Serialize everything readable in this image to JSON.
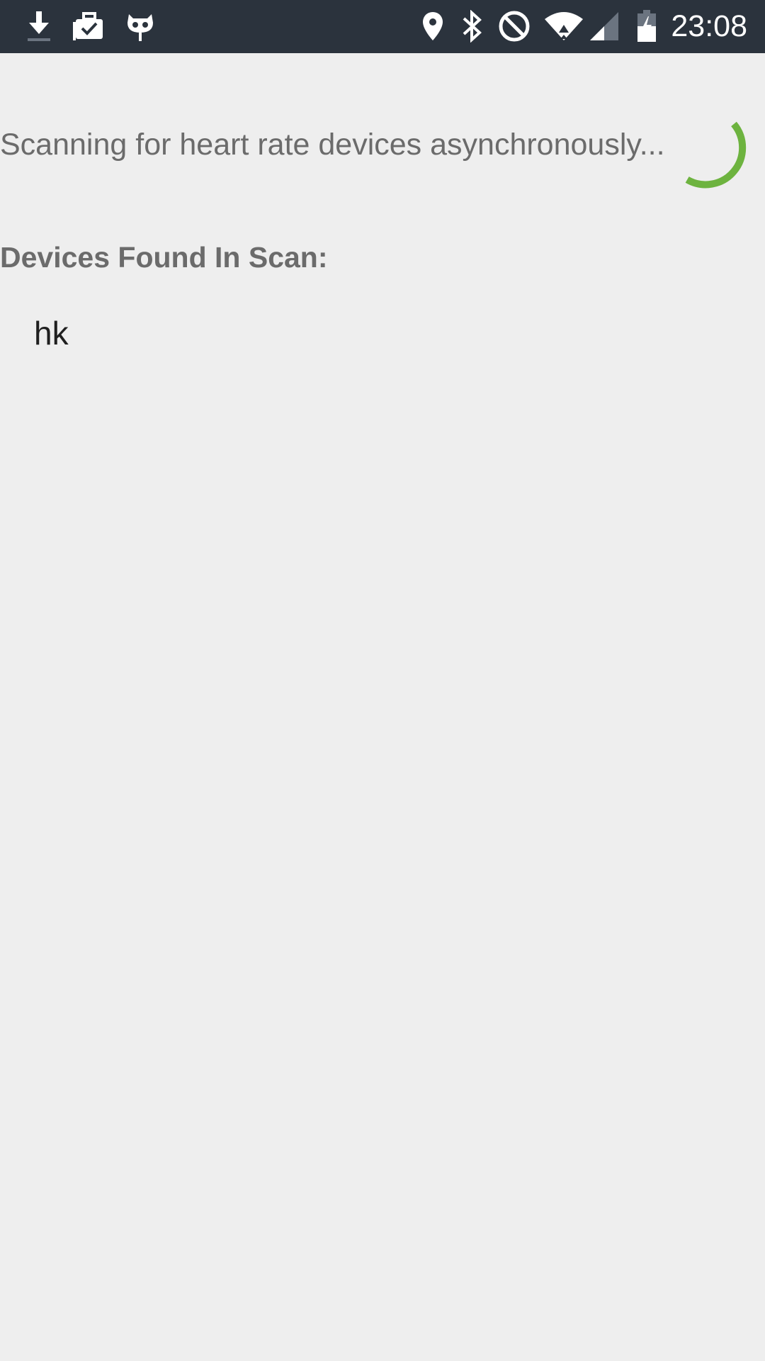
{
  "status_bar": {
    "left_icons": [
      "download-icon",
      "briefcase-check-icon",
      "cyanogen-mascot-icon"
    ],
    "right_icons": [
      "location-pin-icon",
      "bluetooth-icon",
      "do-not-disturb-icon",
      "wifi-icon",
      "cell-signal-icon",
      "battery-charging-icon"
    ],
    "time": "23:08",
    "background": "#2b333d"
  },
  "main": {
    "scan_status": "Scanning for heart rate devices asynchronously...",
    "spinner_color": "#6db33f",
    "devices_heading": "Devices Found In Scan:",
    "devices": [
      "hk"
    ]
  }
}
